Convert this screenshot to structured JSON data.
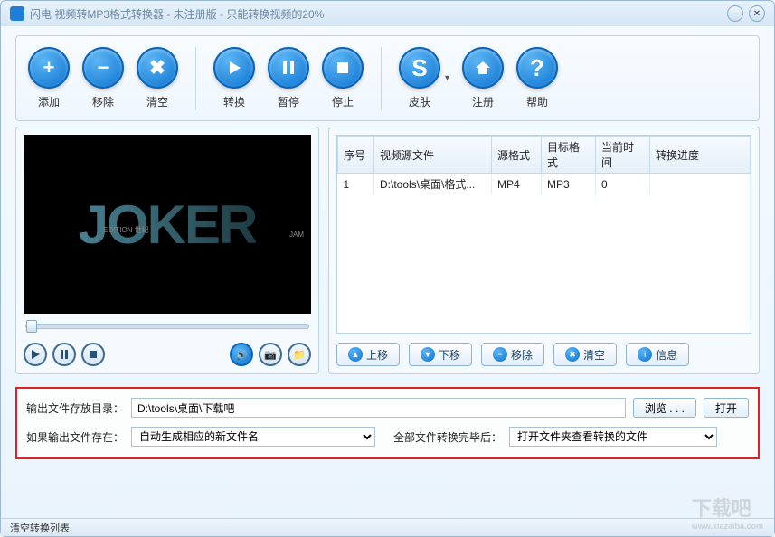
{
  "window": {
    "title": "闪电 视频转MP3格式转换器 - 未注册版 - 只能转换视频的20%"
  },
  "titlebar_buttons": {
    "minimize": "—",
    "close": "✕"
  },
  "toolbar": {
    "add": "添加",
    "remove": "移除",
    "clear": "清空",
    "convert": "转换",
    "pause": "暂停",
    "stop": "停止",
    "skin": "皮肤",
    "register": "注册",
    "help": "帮助"
  },
  "preview": {
    "poster_text": "JOKER",
    "badge_left": "EDITION 世纪",
    "badge_right": "JAM"
  },
  "player": {
    "play": "▶",
    "pause": "❚❚",
    "stop": "■",
    "volume": "🔊",
    "snapshot": "📷",
    "folder": "📁"
  },
  "table": {
    "headers": {
      "index": "序号",
      "source": "视频源文件",
      "srcfmt": "源格式",
      "dstfmt": "目标格式",
      "curtime": "当前时间",
      "progress": "转换进度"
    },
    "rows": [
      {
        "index": "1",
        "source": "D:\\tools\\桌面\\格式...",
        "srcfmt": "MP4",
        "dstfmt": "MP3",
        "curtime": "0",
        "progress": ""
      }
    ]
  },
  "list_buttons": {
    "up": "上移",
    "down": "下移",
    "remove": "移除",
    "clear": "清空",
    "info": "信息"
  },
  "settings": {
    "outdir_label": "输出文件存放目录：",
    "outdir_value": "D:\\tools\\桌面\\下载吧",
    "browse": "浏览 . . .",
    "open": "打开",
    "exists_label": "如果输出文件存在：",
    "exists_value": "自动生成相应的新文件名",
    "after_label": "全部文件转换完毕后：",
    "after_value": "打开文件夹查看转换的文件"
  },
  "statusbar": {
    "text": "清空转换列表"
  },
  "watermark": {
    "big": "下载吧",
    "small": "www.xiazaiba.com"
  }
}
